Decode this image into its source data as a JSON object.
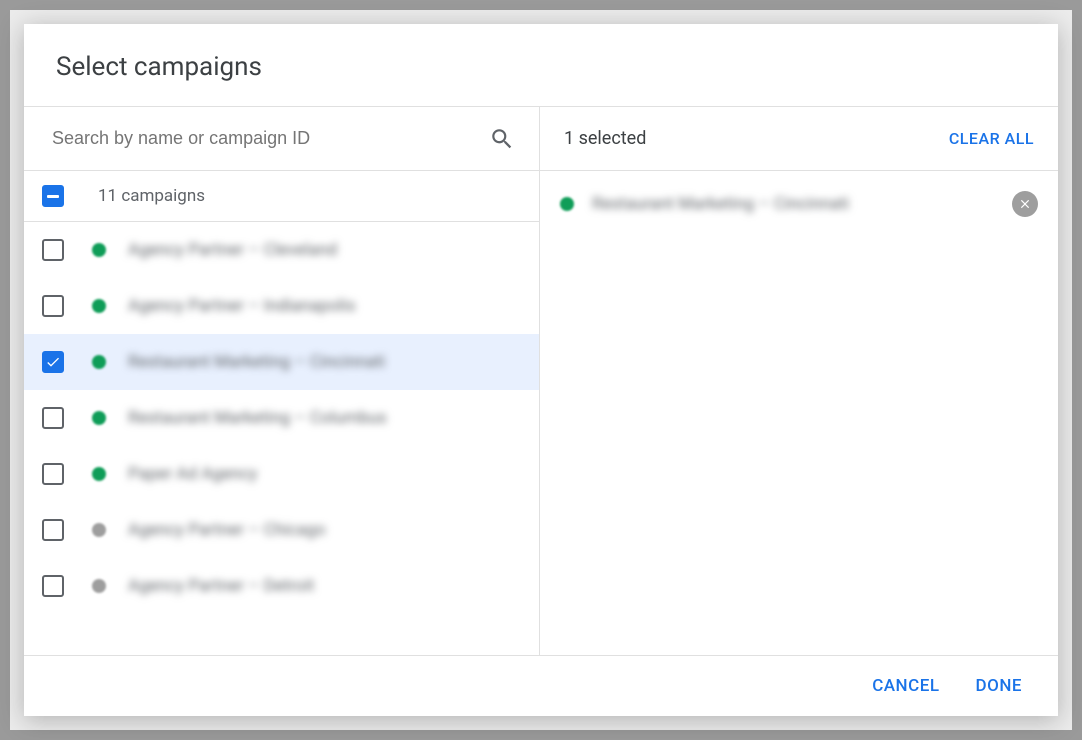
{
  "dialog": {
    "title": "Select campaigns"
  },
  "search": {
    "placeholder": "Search by name or campaign ID",
    "value": ""
  },
  "list": {
    "master_state": "indeterminate",
    "header_label": "11 campaigns",
    "rows": [
      {
        "checked": false,
        "status": "green",
        "label": "Agency Partner – Cleveland"
      },
      {
        "checked": false,
        "status": "green",
        "label": "Agency Partner – Indianapolis"
      },
      {
        "checked": true,
        "status": "green",
        "label": "Restaurant Marketing – Cincinnati"
      },
      {
        "checked": false,
        "status": "green",
        "label": "Restaurant Marketing – Columbus"
      },
      {
        "checked": false,
        "status": "green",
        "label": "Paper Ad Agency"
      },
      {
        "checked": false,
        "status": "grey",
        "label": "Agency Partner – Chicago"
      },
      {
        "checked": false,
        "status": "grey",
        "label": "Agency Partner – Detroit"
      }
    ]
  },
  "right": {
    "selected_label": "1 selected",
    "clear_all": "CLEAR ALL",
    "selected": [
      {
        "status": "green",
        "label": "Restaurant Marketing – Cincinnati"
      }
    ]
  },
  "footer": {
    "cancel": "CANCEL",
    "done": "DONE"
  },
  "colors": {
    "primary": "#1a73e8",
    "status_green": "#0f9d58",
    "status_grey": "#9e9e9e"
  }
}
